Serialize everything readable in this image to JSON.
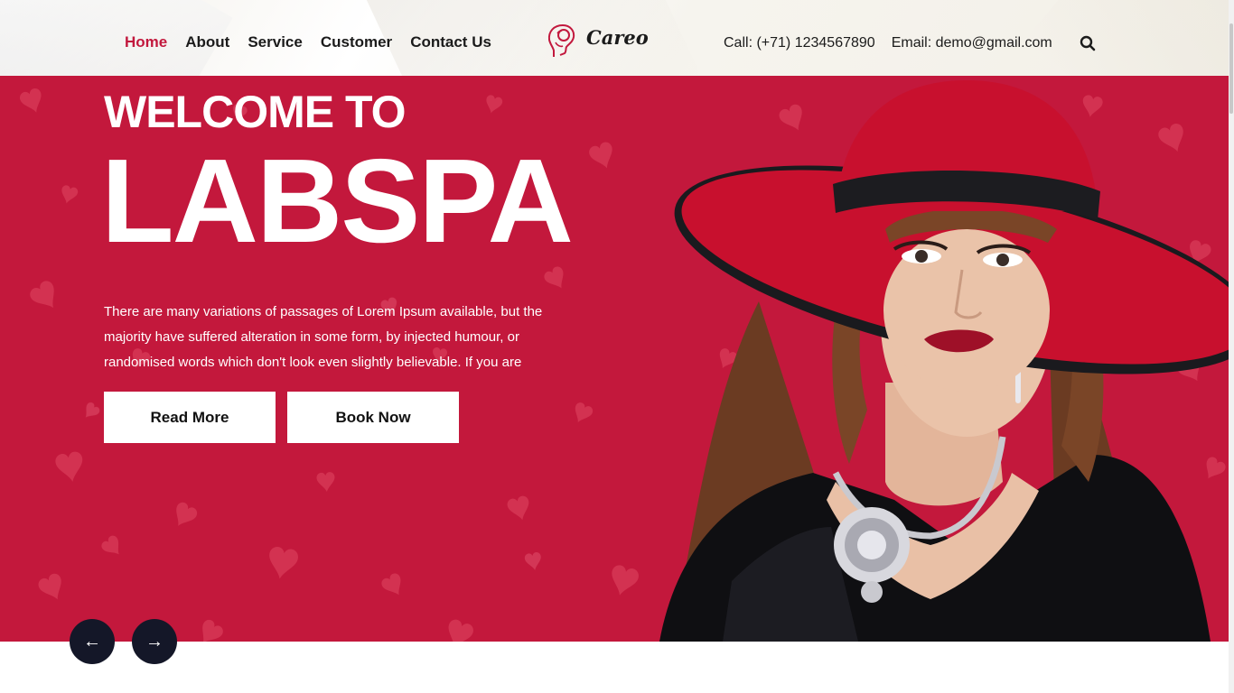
{
  "header": {
    "nav": [
      {
        "label": "Home",
        "active": true
      },
      {
        "label": "About",
        "active": false
      },
      {
        "label": "Service",
        "active": false
      },
      {
        "label": "Customer",
        "active": false
      },
      {
        "label": "Contact Us",
        "active": false
      }
    ],
    "logo_text": "Careo",
    "phone": "Call: (+71) 1234567890",
    "email": "Email: demo@gmail.com",
    "search_icon": "search-icon"
  },
  "hero": {
    "kicker": "WELCOME TO",
    "title": "LABSPA",
    "description": "There are many variations of passages of Lorem Ipsum available, but the majority have suffered alteration in some form, by injected humour, or randomised words which don't look even slightly believable. If you are",
    "read_more_label": "Read More",
    "book_now_label": "Book Now",
    "prev_arrow": "←",
    "next_arrow": "→"
  },
  "colors": {
    "accent": "#c2183d",
    "hero_background": "#c3183c",
    "arrow_button": "#141728",
    "text_dark": "#1b1b1b"
  }
}
